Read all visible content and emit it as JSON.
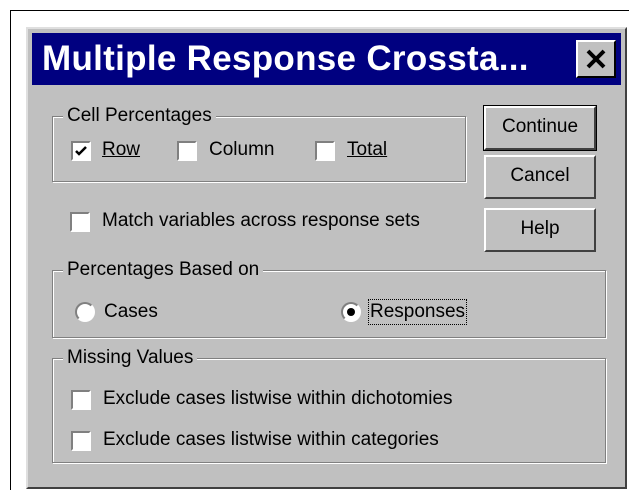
{
  "window": {
    "title": "Multiple Response Crossta..."
  },
  "cell_percentages": {
    "legend": "Cell Percentages",
    "row": {
      "label": "Row",
      "checked": true
    },
    "column": {
      "label": "Column",
      "checked": false
    },
    "total": {
      "label": "Total",
      "checked": false
    }
  },
  "match_variables": {
    "label": "Match variables across response sets",
    "checked": false
  },
  "percentages_based_on": {
    "legend": "Percentages Based on",
    "cases": {
      "label": "Cases",
      "selected": false
    },
    "responses": {
      "label": "Responses",
      "selected": true
    }
  },
  "missing_values": {
    "legend": "Missing Values",
    "dichotomies": {
      "label": "Exclude cases listwise within dichotomies",
      "checked": false
    },
    "categories": {
      "label": "Exclude cases listwise within categories",
      "checked": false
    }
  },
  "buttons": {
    "continue": "Continue",
    "cancel": "Cancel",
    "help": "Help"
  },
  "icons": {
    "close": "close-icon",
    "check": "checkmark-icon"
  }
}
